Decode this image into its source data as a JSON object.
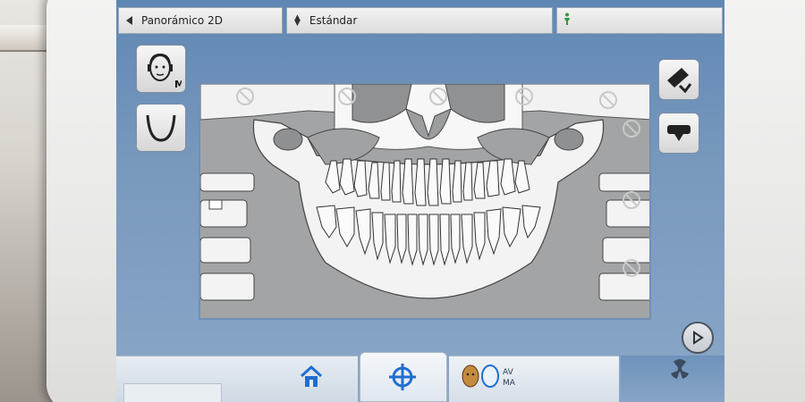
{
  "top_bar": {
    "mode_label": "Panorámico 2D",
    "profile_label": "Estándar"
  },
  "side": {
    "face_size_label": "M"
  },
  "bottom": {
    "patient_badge_top": "AV",
    "patient_badge_bottom": "MA"
  },
  "colors": {
    "screen_bg": "#7898bd",
    "panel_border": "#6f90b8",
    "accent_blue": "#1e6fd0"
  }
}
